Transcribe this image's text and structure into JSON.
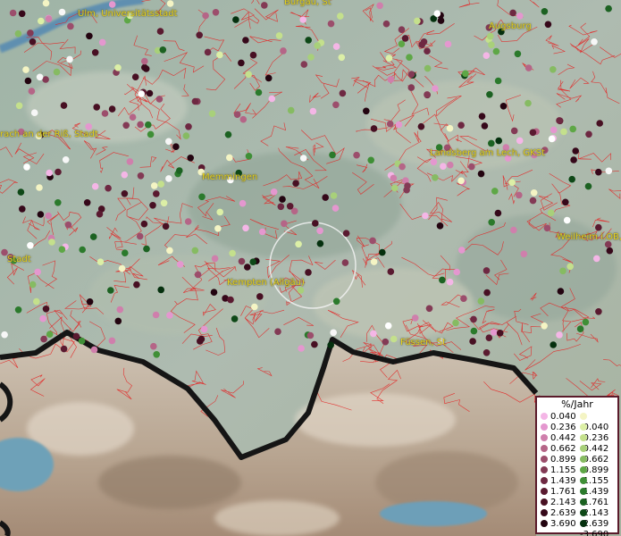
{
  "places": [
    {
      "id": "ulm",
      "label": "Ulm, Universitätsstadt"
    },
    {
      "id": "burgau",
      "label": "Burgau, St"
    },
    {
      "id": "augsburg",
      "label": "Augsburg"
    },
    {
      "id": "biberach",
      "label": "rach an der Riß, Stadt"
    },
    {
      "id": "landsberg",
      "label": "Landsberg am Lech, GKSt"
    },
    {
      "id": "memmingen",
      "label": "Memmingen"
    },
    {
      "id": "weilheim",
      "label": "Weilheim i.OB,"
    },
    {
      "id": "stadt",
      "label": "Stadt"
    },
    {
      "id": "kempten",
      "label": "Kempten (Allgäu)"
    },
    {
      "id": "fuessen",
      "label": "Füssen, St"
    }
  ],
  "legend": {
    "title": "%/Jahr",
    "positive": [
      {
        "label": "0.040",
        "color": "#f4b6e6"
      },
      {
        "label": "0.236",
        "color": "#e497cf"
      },
      {
        "label": "0.442",
        "color": "#cf7fac"
      },
      {
        "label": "0.662",
        "color": "#b56587"
      },
      {
        "label": "0.899",
        "color": "#9c4e6c"
      },
      {
        "label": "1.155",
        "color": "#833a55"
      },
      {
        "label": "1.439",
        "color": "#6e2842"
      },
      {
        "label": "1.761",
        "color": "#5a1a30"
      },
      {
        "label": "2.143",
        "color": "#481023"
      },
      {
        "label": "2.639",
        "color": "#36081a"
      },
      {
        "label": "3.690",
        "color": "#230410"
      }
    ],
    "negative": [
      {
        "label": "-0.040",
        "color": "#f4f4c4"
      },
      {
        "label": "-0.236",
        "color": "#dcefa6"
      },
      {
        "label": "-0.442",
        "color": "#c4e08c"
      },
      {
        "label": "-0.662",
        "color": "#a8d07a"
      },
      {
        "label": "-0.899",
        "color": "#86bb62"
      },
      {
        "label": "-1.155",
        "color": "#5ea746"
      },
      {
        "label": "-1.439",
        "color": "#3f8f36"
      },
      {
        "label": "-1.761",
        "color": "#2b7a2c"
      },
      {
        "label": "-2.143",
        "color": "#1c6222"
      },
      {
        "label": "-2.639",
        "color": "#0e4817"
      },
      {
        "label": "-3.690",
        "color": "#05300e"
      }
    ]
  }
}
